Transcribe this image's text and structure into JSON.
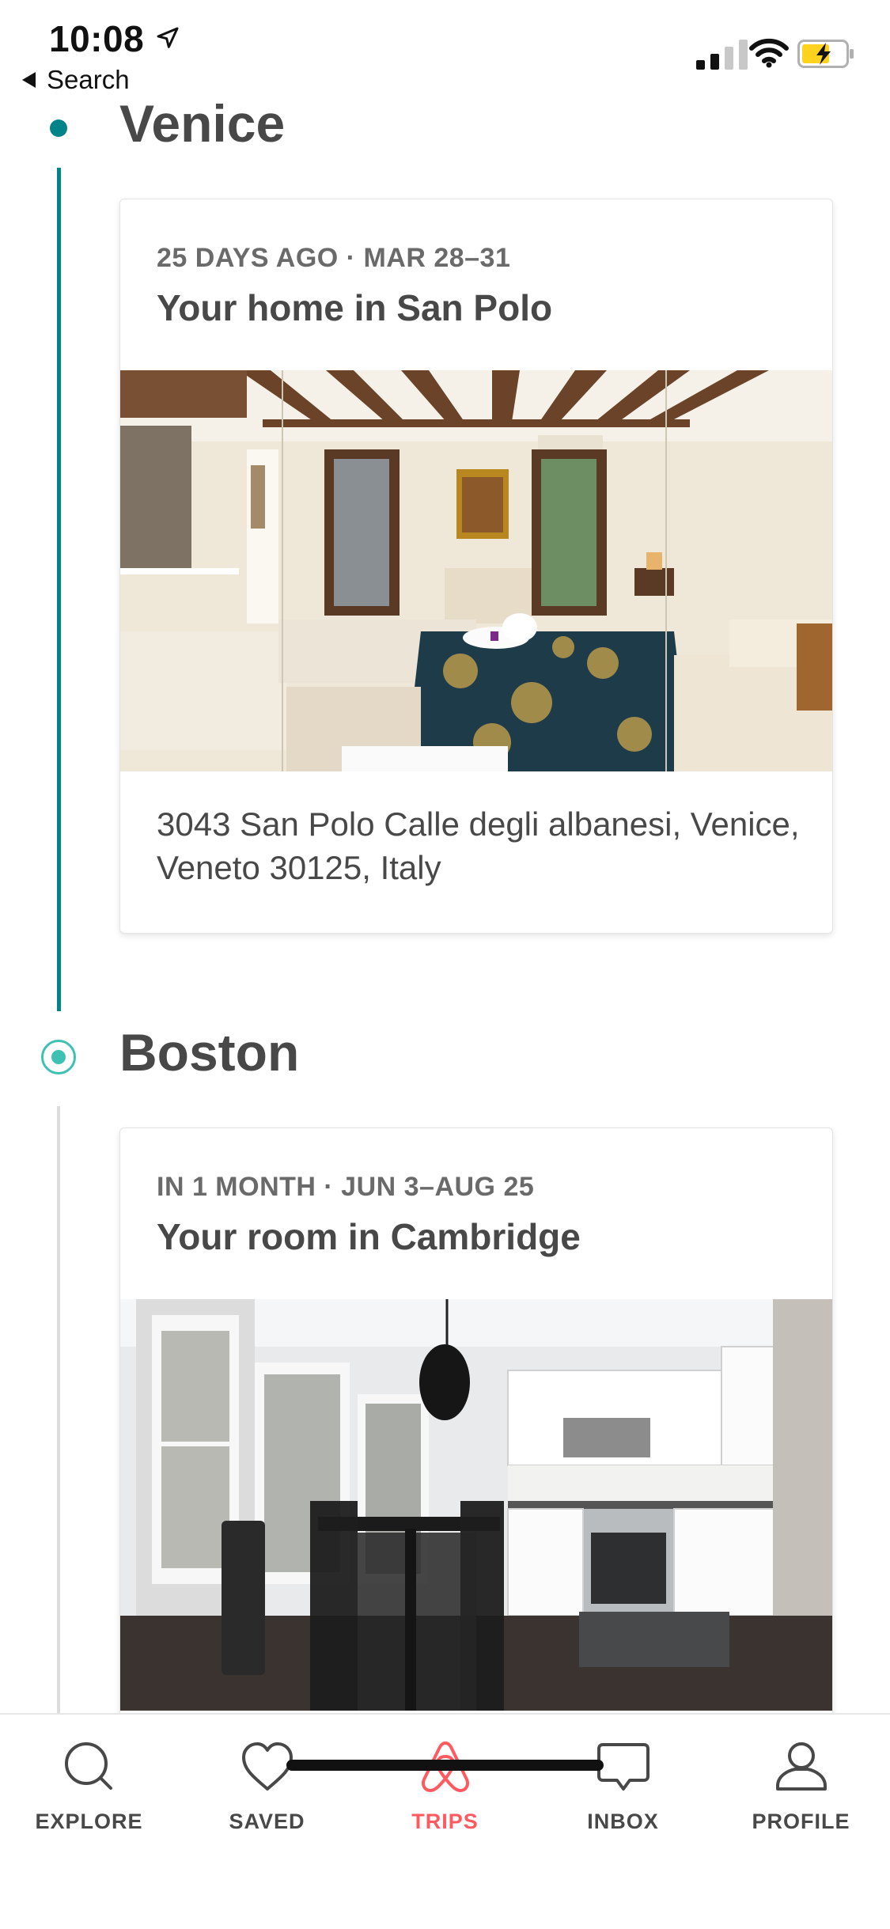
{
  "status_bar": {
    "time": "10:08",
    "back_label": "Search"
  },
  "colors": {
    "accent_teal": "#00848a",
    "accent_mint": "#3ec1b3",
    "brand_red": "#ff5a5f",
    "battery_yellow": "#ffd21f"
  },
  "trips": [
    {
      "city": "Venice",
      "subtitle": "25 DAYS AGO · MAR 28–31",
      "title": "Your home in San Polo",
      "address": "3043 San Polo Calle degli albanesi, Venice, Veneto 30125, Italy",
      "photo_icon": "bedroom-photo"
    },
    {
      "city": "Boston",
      "subtitle": "IN 1 MONTH · JUN 3–AUG 25",
      "title": "Your room in Cambridge",
      "photo_icon": "kitchen-photo"
    }
  ],
  "tab_bar": {
    "active": "trips",
    "tabs": [
      {
        "label": "EXPLORE",
        "icon": "search-icon"
      },
      {
        "label": "SAVED",
        "icon": "heart-icon"
      },
      {
        "label": "TRIPS",
        "icon": "airbnb-logo-icon"
      },
      {
        "label": "INBOX",
        "icon": "message-icon"
      },
      {
        "label": "PROFILE",
        "icon": "user-icon"
      }
    ]
  }
}
